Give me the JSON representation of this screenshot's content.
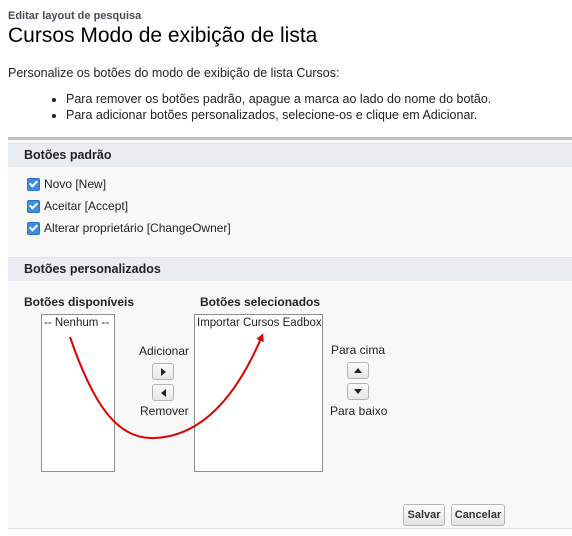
{
  "header": {
    "breadcrumb": "Editar layout de pesquisa",
    "title": "Cursos Modo de exibição de lista"
  },
  "intro": {
    "text": "Personalize os botões do modo de exibição de lista Cursos:",
    "bullets": [
      "Para remover os botões padrão, apague a marca ao lado do nome do botão.",
      "Para adicionar botões personalizados, selecione-os e clique em Adicionar."
    ]
  },
  "standard_buttons": {
    "title": "Botões padrão",
    "items": [
      {
        "label": "Novo [New]",
        "checked": true
      },
      {
        "label": "Aceitar [Accept]",
        "checked": true
      },
      {
        "label": "Alterar proprietário [ChangeOwner]",
        "checked": true
      }
    ]
  },
  "custom_buttons": {
    "title": "Botões personalizados",
    "available_label": "Botões disponíveis",
    "available_options": [
      "-- Nenhum --"
    ],
    "selected_label": "Botões selecionados",
    "selected_options": [
      "Importar Cursos Eadbox"
    ],
    "add_label": "Adicionar",
    "remove_label": "Remover",
    "up_label": "Para cima",
    "down_label": "Para baixo"
  },
  "actions": {
    "save_label": "Salvar",
    "cancel_label": "Cancelar"
  },
  "colors": {
    "checkbox": "#3b8de0",
    "section_header": "#e9edf2",
    "annotation_arrow": "#e00000"
  }
}
